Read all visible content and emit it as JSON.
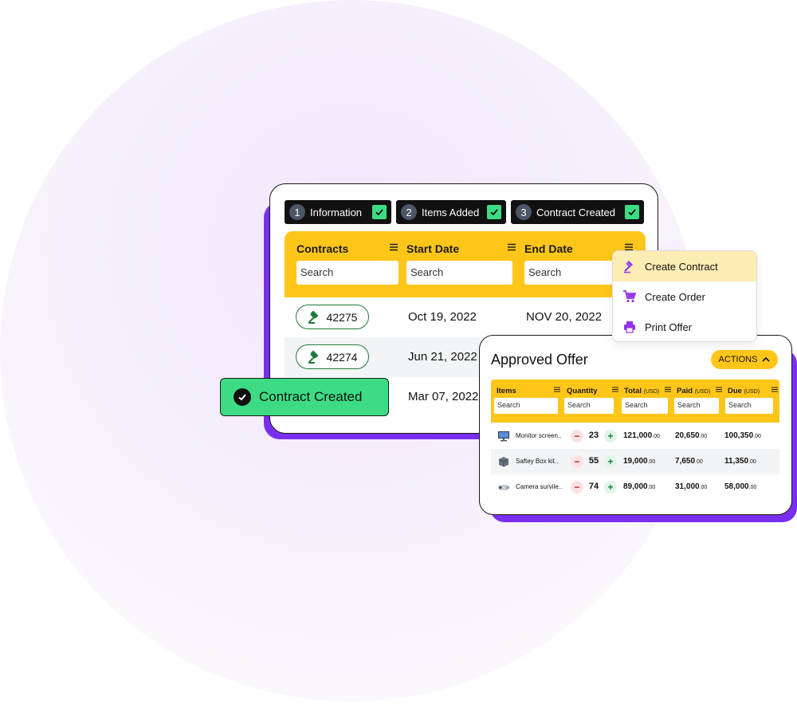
{
  "steps": [
    {
      "number": "1",
      "label": "Information"
    },
    {
      "number": "2",
      "label": "Items Added"
    },
    {
      "number": "3",
      "label": "Contract Created"
    }
  ],
  "contracts_table": {
    "columns": [
      "Contracts",
      "Start Date",
      "End Date"
    ],
    "search_placeholder": "Search",
    "rows": [
      {
        "id": "42275",
        "start": "Oct 19, 2022",
        "end": "NOV 20, 2022"
      },
      {
        "id": "42274",
        "start": "Jun 21, 2022",
        "end": ""
      },
      {
        "id": "",
        "start": "Mar 07, 2022",
        "end": ""
      }
    ]
  },
  "toast": {
    "label": "Contract Created"
  },
  "menu": {
    "items": [
      {
        "label": "Create Contract",
        "icon": "gavel-icon"
      },
      {
        "label": "Create Order",
        "icon": "cart-icon"
      },
      {
        "label": "Print Offer",
        "icon": "printer-icon"
      }
    ]
  },
  "offer": {
    "title": "Approved Offer",
    "actions_label": "ACTIONS",
    "columns": [
      "Items",
      "Quantity",
      "Total",
      "Paid",
      "Due"
    ],
    "unit": "(USD)",
    "search_placeholder": "Search",
    "rows": [
      {
        "item": "Monitor screen..",
        "qty": "23",
        "total": "121,000",
        "paid": "20,650",
        "due": "100,350",
        "dec": ".00"
      },
      {
        "item": "Saftey Box kit..",
        "qty": "55",
        "total": "19,000",
        "paid": "7,650",
        "due": "11,350",
        "dec": ".00"
      },
      {
        "item": "Camera survile..",
        "qty": "74",
        "total": "89,000",
        "paid": "31,000",
        "due": "58,000",
        "dec": ".00"
      }
    ]
  },
  "colors": {
    "accent_yellow": "#ffc61a",
    "accent_purple": "#7a2ff0",
    "success_green": "#3ddc84"
  }
}
